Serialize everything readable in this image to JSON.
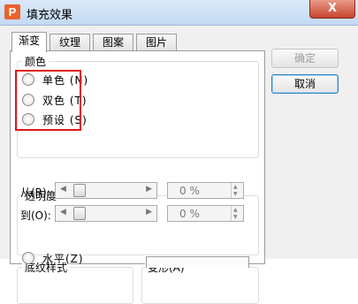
{
  "window": {
    "title": "填充效果",
    "close_label": "X",
    "app_icon": "wps-presentation-icon"
  },
  "tabs": [
    {
      "label": "渐变",
      "active": true
    },
    {
      "label": "纹理",
      "active": false
    },
    {
      "label": "图案",
      "active": false
    },
    {
      "label": "图片",
      "active": false
    }
  ],
  "color_group": {
    "title": "颜色",
    "options": [
      {
        "label": "单色",
        "accel": "(N)",
        "checked": false
      },
      {
        "label": "双色",
        "accel": "(T)",
        "checked": false
      },
      {
        "label": "预设",
        "accel": "(S)",
        "checked": false
      }
    ],
    "highlight_color": "#e0151b"
  },
  "transparency_group": {
    "title": "透明度",
    "from": {
      "label": "从(R):",
      "value": "0 %"
    },
    "to": {
      "label": "到(O):",
      "value": "0 %"
    }
  },
  "shading_group": {
    "title": "底纹样式",
    "first_option": "水平(Z)"
  },
  "variants_group": {
    "title": "变形(A)"
  },
  "buttons": {
    "ok": "确定",
    "cancel": "取消"
  }
}
